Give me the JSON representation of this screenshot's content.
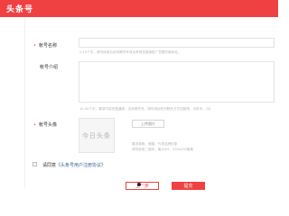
{
  "header": {
    "logo_text": "头条号"
  },
  "form": {
    "name": {
      "label": "帐号名称",
      "value": "",
      "hint": "2-10个字，请勿使用包含特殊符号或含有明显营销推广意图的媒体名。"
    },
    "intro": {
      "label": "帐号介绍",
      "value": "",
      "hint": "10-30个字，要求内容完整通顺，无特殊符号，请勿添加任何联系方式如微博、手机号、QQ"
    },
    "avatar": {
      "label": "帐号头像",
      "placeholder_text": "今日头条",
      "upload_label": "上传图片",
      "hints": [
        "要求清晰、健康、代表品牌形象",
        "请勿使用二维码，最大5M，200x200像素"
      ]
    },
    "agree": {
      "prefix": "请同意",
      "link": "《头条号用户注册协议》"
    },
    "buttons": {
      "prev_label": "上一步",
      "submit_label": "提交"
    }
  },
  "colors": {
    "brand": "#f04142",
    "link": "#406599"
  }
}
